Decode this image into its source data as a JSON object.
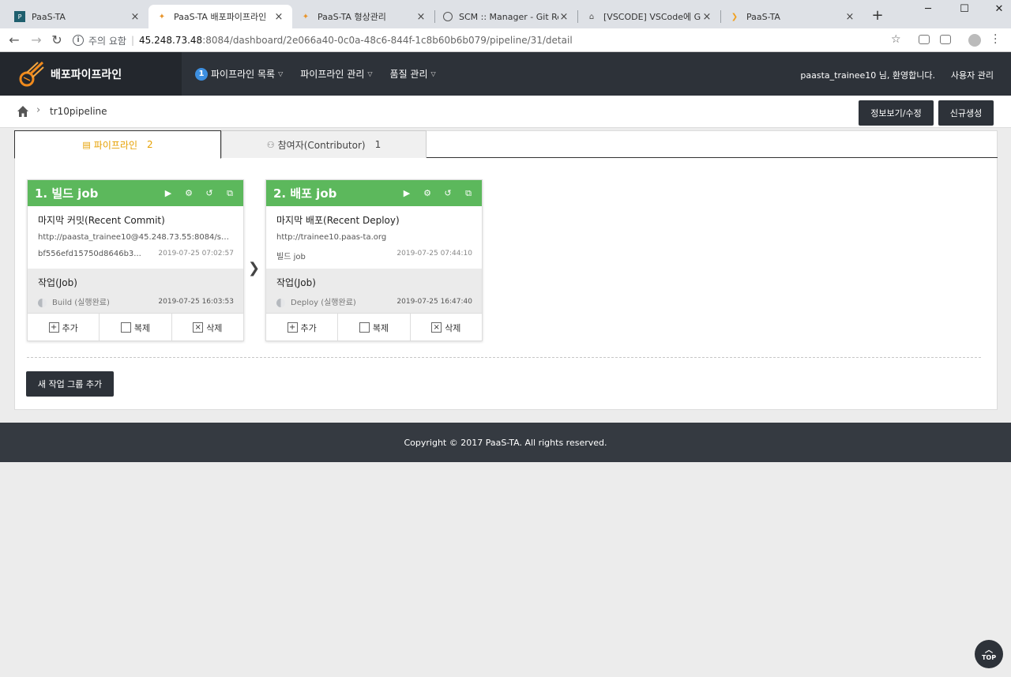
{
  "browser": {
    "tabs": [
      {
        "title": "PaaS-TA",
        "icon": "paas-ta-icon"
      },
      {
        "title": "PaaS-TA 배포파이프라인",
        "icon": "pipeline-icon"
      },
      {
        "title": "PaaS-TA 형상관리",
        "icon": "pipeline-icon"
      },
      {
        "title": "SCM :: Manager - Git Repos",
        "icon": "globe-icon"
      },
      {
        "title": "[VSCODE] VSCode에 Git 사용",
        "icon": "house-icon"
      },
      {
        "title": "PaaS-TA",
        "icon": "paas-ta-icon"
      }
    ],
    "close_glyph": "×",
    "new_tab_glyph": "+",
    "security_label": "주의 요함",
    "url_host": "45.248.73.48",
    "url_path": ":8084/dashboard/2e066a40-0c0a-48c6-844f-1c8b60b6b079/pipeline/31/detail"
  },
  "header": {
    "logo_text": "배포파이프라인",
    "nav": [
      {
        "label": "파이프라인 목록",
        "badge": "1"
      },
      {
        "label": "파이프라인 관리"
      },
      {
        "label": "품질 관리"
      }
    ],
    "user_greeting": "paasta_trainee10 님, 환영합니다.",
    "admin_link": "사용자 관리"
  },
  "breadcrumb": {
    "current": "tr10pipeline",
    "info_button": "정보보기/수정",
    "new_button": "신규생성"
  },
  "content_tabs": [
    {
      "label": "파이프라인",
      "count": "2"
    },
    {
      "label": "참여자(Contributor)",
      "count": "1"
    }
  ],
  "jobs": [
    {
      "title": "1. 빌드 job",
      "section_title": "마지막 커밋(Recent Commit)",
      "line1": "http://paasta_trainee10@45.248.73.55:8084/sc...",
      "line1_date": "",
      "line2": "bf556efd15750d8646b3...",
      "line2_date": "2019-07-25 07:02:57",
      "work_title": "작업(Job)",
      "status": "Build (실행완료)",
      "status_date": "2019-07-25 16:03:53"
    },
    {
      "title": "2. 배포 job",
      "section_title": "마지막 배포(Recent Deploy)",
      "line1": "http://trainee10.paas-ta.org",
      "line1_date": "",
      "line2": "빌드 job",
      "line2_date": "2019-07-25 07:44:10",
      "work_title": "작업(Job)",
      "status": "Deploy (실행완료)",
      "status_date": "2019-07-25 16:47:40"
    }
  ],
  "job_actions": {
    "add": "추가",
    "copy": "복제",
    "delete": "삭제"
  },
  "add_group_button": "새 작업 그룹 추가",
  "footer": "Copyright © 2017 PaaS-TA. All rights reserved.",
  "top_button": "TOP",
  "colors": {
    "header_bg": "#2d3239",
    "job_header": "#5cb85c",
    "active_tab_text": "#e6a000",
    "badge": "#3d8fe0"
  }
}
